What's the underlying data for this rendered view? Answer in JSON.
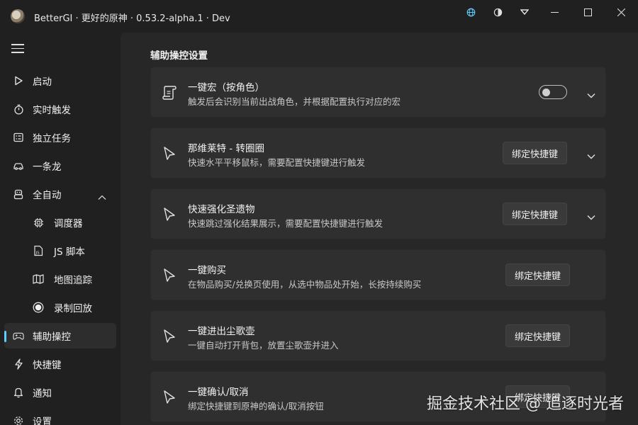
{
  "window": {
    "title": "BetterGI · 更好的原神 · 0.53.2-alpha.1 · Dev",
    "accent_color": "#60cdff"
  },
  "sidebar": {
    "items": [
      {
        "label": "启动",
        "icon": "play-icon"
      },
      {
        "label": "实时触发",
        "icon": "stopwatch-icon"
      },
      {
        "label": "独立任务",
        "icon": "tasklist-icon"
      },
      {
        "label": "一条龙",
        "icon": "car-icon"
      },
      {
        "label": "全自动",
        "icon": "robot-icon",
        "expanded": true
      },
      {
        "label": "调度器",
        "icon": "chip-icon",
        "sub": true
      },
      {
        "label": "JS 脚本",
        "icon": "js-file-icon",
        "sub": true
      },
      {
        "label": "地图追踪",
        "icon": "map-icon",
        "sub": true
      },
      {
        "label": "录制回放",
        "icon": "record-icon",
        "sub": true
      },
      {
        "label": "辅助操控",
        "icon": "gamepad-icon",
        "active": true
      },
      {
        "label": "快捷键",
        "icon": "lightning-icon"
      },
      {
        "label": "通知",
        "icon": "bell-icon"
      },
      {
        "label": "设置",
        "icon": "gear-icon"
      }
    ]
  },
  "main": {
    "section_title": "辅助操控设置",
    "cards": [
      {
        "title": "一键宏（按角色）",
        "desc": "触发后会识别当前出战角色，并根据配置执行对应的宏",
        "control": "toggle",
        "toggle_on": false,
        "expandable": true,
        "icon": "scroll-icon"
      },
      {
        "title": "那维莱特 - 转圈圈",
        "desc": "快速水平平移鼠标，需要配置快捷键进行触发",
        "control": "button",
        "button_label": "绑定快捷键",
        "expandable": true,
        "icon": "cursor-icon"
      },
      {
        "title": "快速强化圣遗物",
        "desc": "快速跳过强化结果展示，需要配置快捷键进行触发",
        "control": "button",
        "button_label": "绑定快捷键",
        "expandable": true,
        "icon": "cursor-icon"
      },
      {
        "title": "一键购买",
        "desc": "在物品购买/兑换页使用，从选中物品处开始，长按持续购买",
        "control": "button",
        "button_label": "绑定快捷键",
        "expandable": false,
        "icon": "cursor-icon"
      },
      {
        "title": "一键进出尘歌壶",
        "desc": "一键自动打开背包，放置尘歌壶并进入",
        "control": "button",
        "button_label": "绑定快捷键",
        "expandable": false,
        "icon": "cursor-icon"
      },
      {
        "title": "一键确认/取消",
        "desc": "绑定快捷键到原神的确认/取消按钮",
        "control": "button",
        "button_label": "绑定快捷键",
        "expandable": false,
        "icon": "cursor-icon"
      }
    ]
  },
  "watermark": "掘金技术社区 @ 追逐时光者"
}
